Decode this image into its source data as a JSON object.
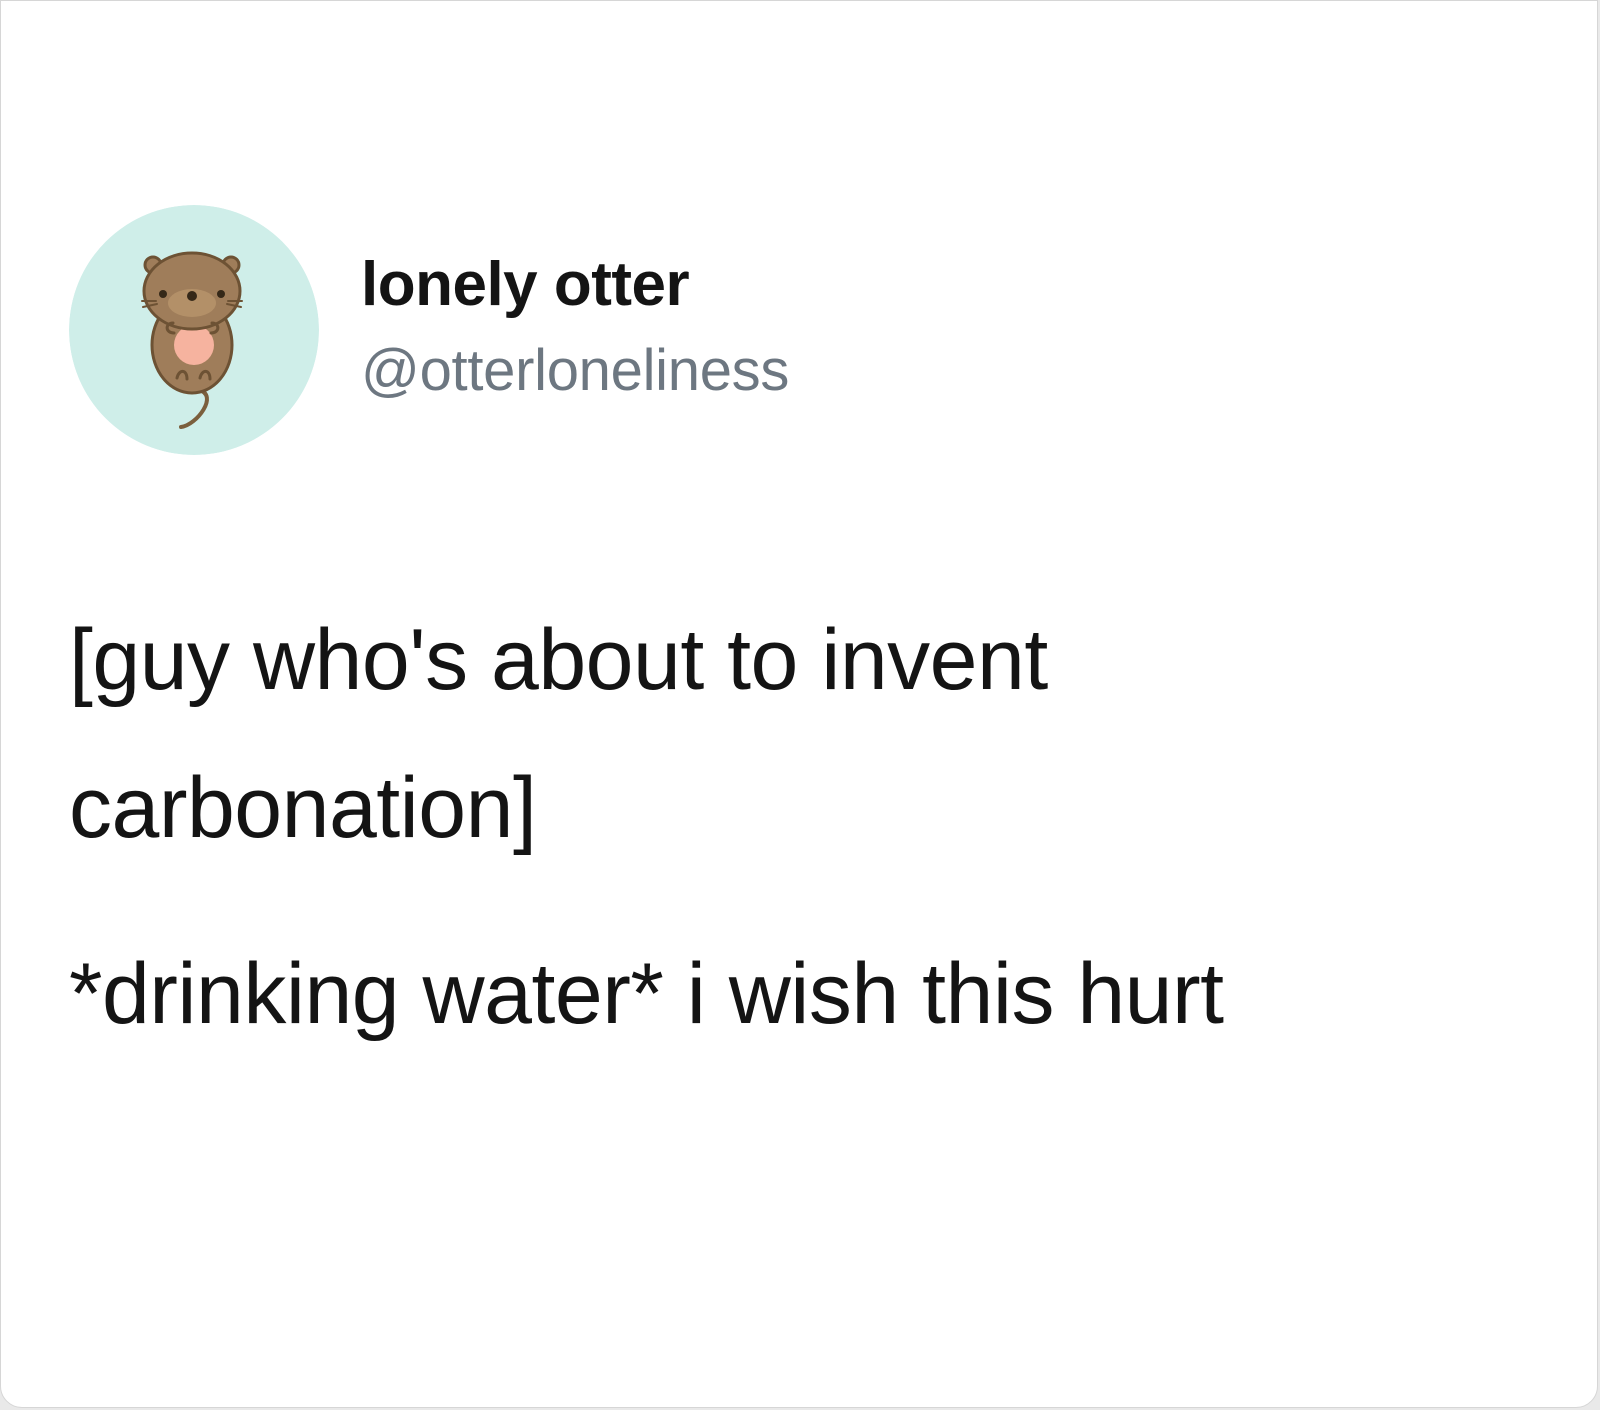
{
  "tweet": {
    "author": {
      "display_name": "lonely otter",
      "handle": "@otterloneliness",
      "avatar_icon": "otter-avatar-icon",
      "avatar_bg_color": "#cfeee9"
    },
    "text_lines": [
      "[guy who's about to invent",
      "carbonation]",
      "*drinking water* i wish this hurt"
    ]
  },
  "colors": {
    "text": "#141414",
    "handle": "#6d7781",
    "background": "#ffffff"
  }
}
